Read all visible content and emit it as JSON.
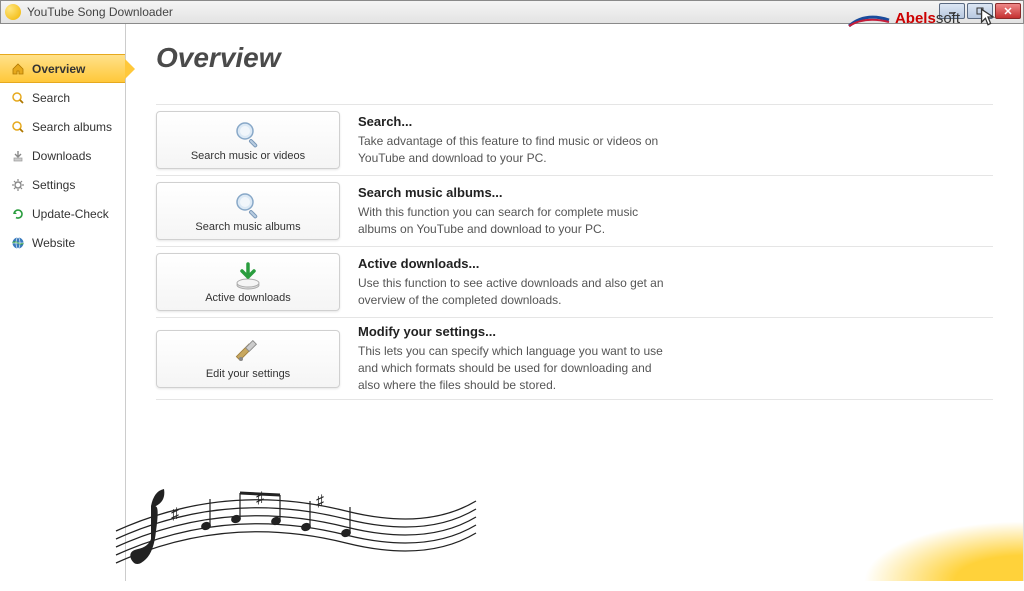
{
  "window": {
    "title": "YouTube Song Downloader"
  },
  "brand": {
    "name_prefix": "Abels",
    "name_suffix": "soft"
  },
  "page": {
    "title": "Overview"
  },
  "nav": {
    "items": [
      {
        "label": "Overview",
        "icon": "home-icon",
        "active": true
      },
      {
        "label": "Search",
        "icon": "search-icon"
      },
      {
        "label": "Search albums",
        "icon": "search-icon"
      },
      {
        "label": "Downloads",
        "icon": "download-icon"
      },
      {
        "label": "Settings",
        "icon": "gear-icon"
      },
      {
        "label": "Update-Check",
        "icon": "refresh-icon"
      },
      {
        "label": "Website",
        "icon": "globe-icon"
      }
    ]
  },
  "cards": {
    "items": [
      {
        "button_label": "Search music or videos",
        "title": "Search...",
        "desc": "Take advantage of this feature to find music or videos on YouTube and download to your PC.",
        "icon": "magnifier-icon"
      },
      {
        "button_label": "Search music albums",
        "title": "Search music albums...",
        "desc": "With this function you can search for complete music albums on YouTube and download to your PC.",
        "icon": "magnifier-icon"
      },
      {
        "button_label": "Active downloads",
        "title": "Active downloads...",
        "desc": "Use this function to see active downloads and also get an overview of the completed downloads.",
        "icon": "download-arrow-icon"
      },
      {
        "button_label": "Edit your settings",
        "title": "Modify your settings...",
        "desc": "This lets you can specify which language you want to use and which formats should be used for downloading and also where the files should be stored.",
        "icon": "tools-icon"
      }
    ]
  }
}
